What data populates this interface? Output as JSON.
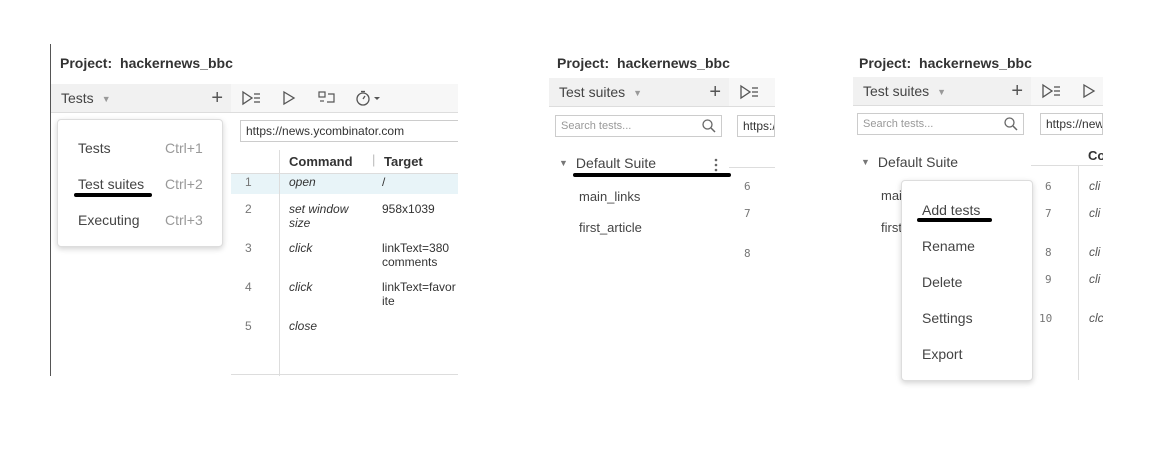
{
  "project": {
    "label": "Project:",
    "name": "hackernews_bbc"
  },
  "panel1": {
    "side_header": "Tests",
    "url": "https://news.ycombinator.com",
    "columns": {
      "command": "Command",
      "target": "Target"
    },
    "rows": [
      {
        "n": "1",
        "command": "open",
        "target": "/"
      },
      {
        "n": "2",
        "command": "set window size",
        "target": "958x1039"
      },
      {
        "n": "3",
        "command": "click",
        "target": "linkText=380 comments"
      },
      {
        "n": "4",
        "command": "click",
        "target": "linkText=favorite"
      },
      {
        "n": "5",
        "command": "close",
        "target": ""
      }
    ],
    "dropdown": [
      {
        "label": "Tests",
        "shortcut": "Ctrl+1"
      },
      {
        "label": "Test suites",
        "shortcut": "Ctrl+2"
      },
      {
        "label": "Executing",
        "shortcut": "Ctrl+3"
      }
    ]
  },
  "panel2": {
    "side_header": "Test suites",
    "search_placeholder": "Search tests...",
    "url_fragment": "https:/",
    "suite": "Default Suite",
    "tests": [
      "main_links",
      "first_article"
    ],
    "line_numbers": [
      "6",
      "7",
      "8"
    ]
  },
  "panel3": {
    "side_header": "Test suites",
    "search_placeholder": "Search tests...",
    "url_fragment": "https://new",
    "suite": "Default Suite",
    "column_fragment": "Co",
    "tests_partial": [
      "mai",
      "first"
    ],
    "line_numbers": [
      "6",
      "7",
      "8",
      "9",
      "10"
    ],
    "command_fragments": [
      "cli",
      "cli",
      "cli",
      "cli",
      "clc"
    ],
    "context_menu": [
      "Add tests",
      "Rename",
      "Delete",
      "Settings",
      "Export"
    ]
  },
  "colors": {
    "header_bg": "#f1f1f1",
    "highlight_row": "#e8f4f8",
    "underline": "#000000"
  },
  "icons": [
    "plus-icon",
    "caret-down-icon",
    "play-suite-icon",
    "play-icon",
    "record-icon",
    "timer-icon",
    "search-icon",
    "kebab-icon"
  ]
}
